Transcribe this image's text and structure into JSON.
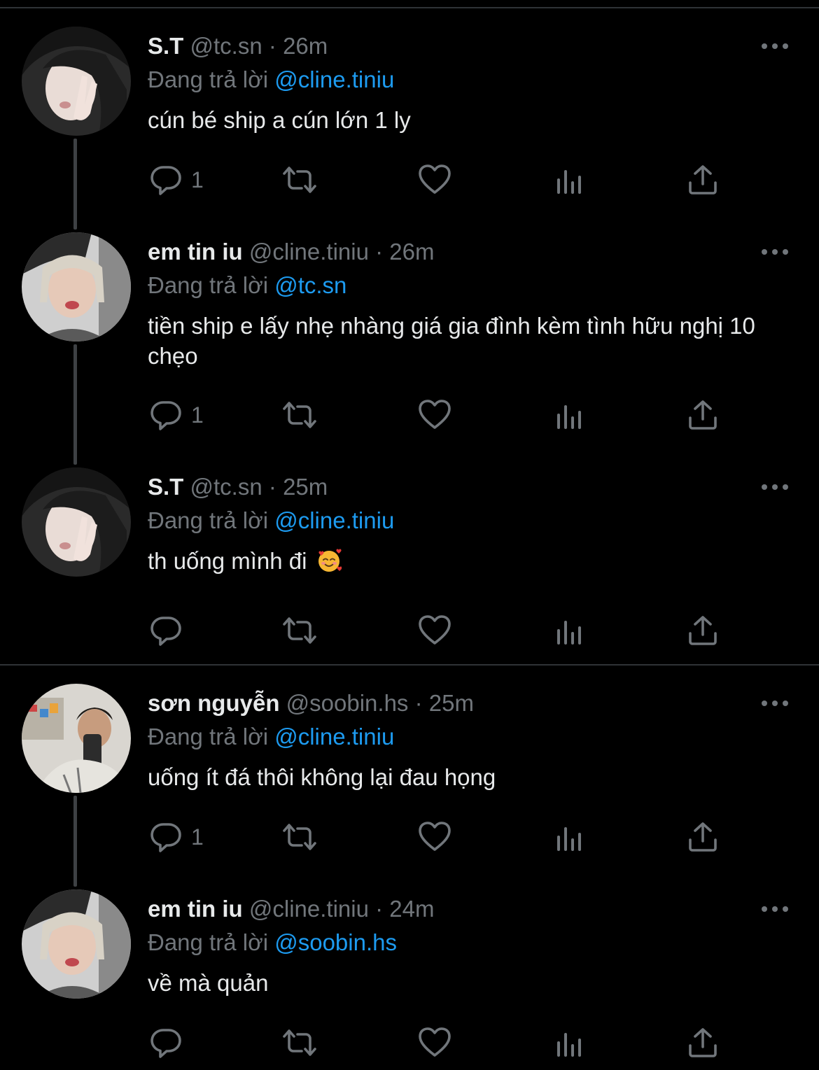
{
  "tweets": [
    {
      "name": "S.T",
      "handle": "@tc.sn",
      "time": "26m",
      "reply_prefix": "Đang trả lời",
      "reply_to": "@cline.tiniu",
      "text": "cún bé ship a cún lớn 1 ly",
      "reply_count": "1"
    },
    {
      "name": "em tin iu",
      "handle": "@cline.tiniu",
      "time": "26m",
      "reply_prefix": "Đang trả lời",
      "reply_to": "@tc.sn",
      "text": "tiền ship e lấy nhẹ nhàng giá gia đình kèm tình hữu nghị 10 chẹo",
      "reply_count": "1"
    },
    {
      "name": "S.T",
      "handle": "@tc.sn",
      "time": "25m",
      "reply_prefix": "Đang trả lời",
      "reply_to": "@cline.tiniu",
      "text": "th uống mình đi",
      "emoji": "smiling-face-with-hearts",
      "reply_count": ""
    },
    {
      "name": "sơn nguyễn",
      "handle": "@soobin.hs",
      "time": "25m",
      "reply_prefix": "Đang trả lời",
      "reply_to": "@cline.tiniu",
      "text": "uống ít đá thôi không lại đau họng",
      "reply_count": "1"
    },
    {
      "name": "em tin iu",
      "handle": "@cline.tiniu",
      "time": "24m",
      "reply_prefix": "Đang trả lời",
      "reply_to": "@soobin.hs",
      "text": "về mà quản",
      "reply_count": ""
    }
  ],
  "separator": "·",
  "icons": [
    "reply-icon",
    "retweet-icon",
    "like-icon",
    "views-icon",
    "share-icon",
    "more-icon"
  ],
  "colors": {
    "background": "#000000",
    "text": "#e7e9ea",
    "secondary": "#71767b",
    "mention": "#1d9bf0",
    "divider": "#2f3336"
  }
}
